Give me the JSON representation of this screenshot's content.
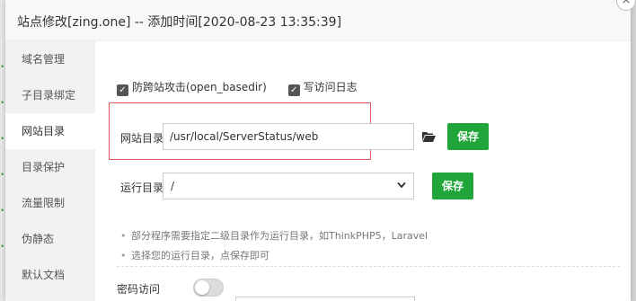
{
  "dialog": {
    "title": "站点修改[zing.one] -- 添加时间[2020-08-23 13:35:39]",
    "close_glyph": "×"
  },
  "sidebar": {
    "items": [
      {
        "label": "域名管理",
        "active": false
      },
      {
        "label": "子目录绑定",
        "active": false
      },
      {
        "label": "网站目录",
        "active": true
      },
      {
        "label": "目录保护",
        "active": false
      },
      {
        "label": "流量限制",
        "active": false
      },
      {
        "label": "伪静态",
        "active": false
      },
      {
        "label": "默认文档",
        "active": false
      }
    ]
  },
  "options": {
    "anti_xss_label": "防跨站攻击(open_basedir)",
    "anti_xss_checked": true,
    "access_log_label": "写访问日志",
    "access_log_checked": true
  },
  "site_dir": {
    "label": "网站目录",
    "value": "/usr/local/ServerStatus/web",
    "save_label": "保存",
    "folder_icon": "folder-open-icon"
  },
  "run_dir": {
    "label": "运行目录",
    "value": "/",
    "save_label": "保存"
  },
  "tips": [
    "部分程序需要指定二级目录作为运行目录，如ThinkPHP5，Laravel",
    "选择您的运行目录，点保存即可"
  ],
  "password_access": {
    "label": "密码访问",
    "enabled": false
  },
  "colors": {
    "accent": "#20a53a",
    "highlight_border": "#e35a5a"
  }
}
